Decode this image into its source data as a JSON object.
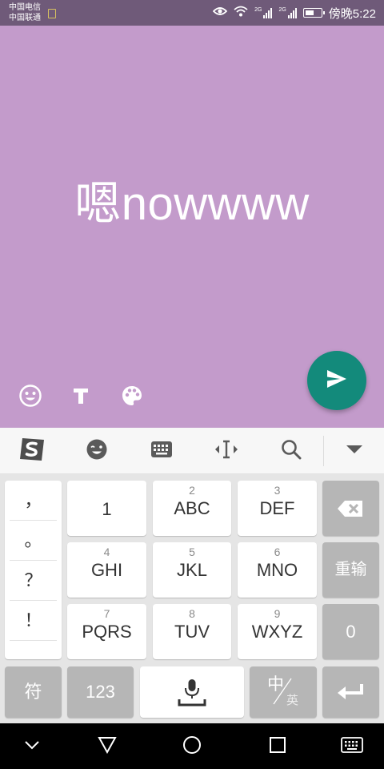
{
  "status_bar": {
    "carrier_1": "中国电信",
    "carrier_2": "中国联通",
    "net_1": "2G",
    "net_2": "2G",
    "net_3": "2G",
    "time": "傍晚5:22",
    "battery_level": 0.6,
    "icons": [
      "eye-comfort-icon",
      "wifi-icon",
      "signal-icon",
      "signal-icon",
      "battery-icon"
    ]
  },
  "compose": {
    "background_color": "#c39bcb",
    "text": "嗯nowwww",
    "tools": [
      "emoji-icon",
      "text-format-icon",
      "palette-icon"
    ],
    "send_color": "#138a7b"
  },
  "ime_toolbar": {
    "icons": [
      "sogou-logo-icon",
      "emoji-face-icon",
      "keyboard-icon",
      "cursor-move-icon",
      "search-icon",
      "collapse-icon"
    ]
  },
  "keyboard": {
    "punctuation": [
      "，",
      "。",
      "？",
      "！"
    ],
    "keys": {
      "k1": {
        "num": "",
        "label": "1"
      },
      "k2": {
        "num": "2",
        "label": "ABC"
      },
      "k3": {
        "num": "3",
        "label": "DEF"
      },
      "k4": {
        "num": "4",
        "label": "GHI"
      },
      "k5": {
        "num": "5",
        "label": "JKL"
      },
      "k6": {
        "num": "6",
        "label": "MNO"
      },
      "k7": {
        "num": "7",
        "label": "PQRS"
      },
      "k8": {
        "num": "8",
        "label": "TUV"
      },
      "k9": {
        "num": "9",
        "label": "WXYZ"
      }
    },
    "backspace": "backspace-icon",
    "reenter_label": "重输",
    "zero_label": "0",
    "symbol_label": "符",
    "numeric_label": "123",
    "lang_primary": "中",
    "lang_secondary": "英",
    "enter": "enter-icon"
  },
  "nav_bar": {
    "icons": [
      "collapse-chevron-icon",
      "back-icon",
      "home-icon",
      "recents-icon",
      "keyboard-switch-icon"
    ]
  }
}
